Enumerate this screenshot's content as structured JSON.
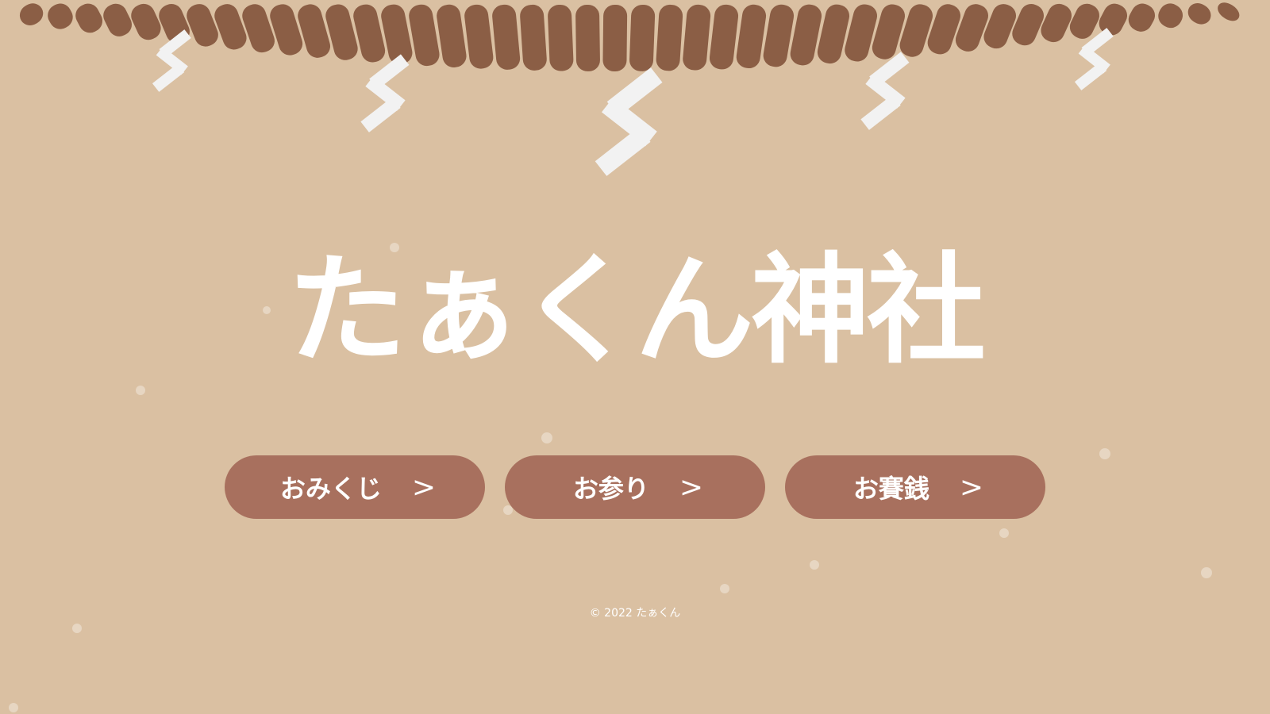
{
  "site": {
    "title": "たぁくん神社",
    "copyright": "© 2022 たぁくん"
  },
  "nav": {
    "items": [
      {
        "label": "おみくじ",
        "arrow": ">"
      },
      {
        "label": "お参り",
        "arrow": ">"
      },
      {
        "label": "お賽銭",
        "arrow": ">"
      }
    ]
  },
  "colors": {
    "background": "#dac0a2",
    "rope": "#8b5e45",
    "shide_paper": "#f2f2f2",
    "button": "#a8705e",
    "text": "#ffffff"
  },
  "icons": {
    "rope": "shimenawa-rope",
    "paper": "shide-paper-streamer",
    "arrow": "greater-than-glyph"
  }
}
